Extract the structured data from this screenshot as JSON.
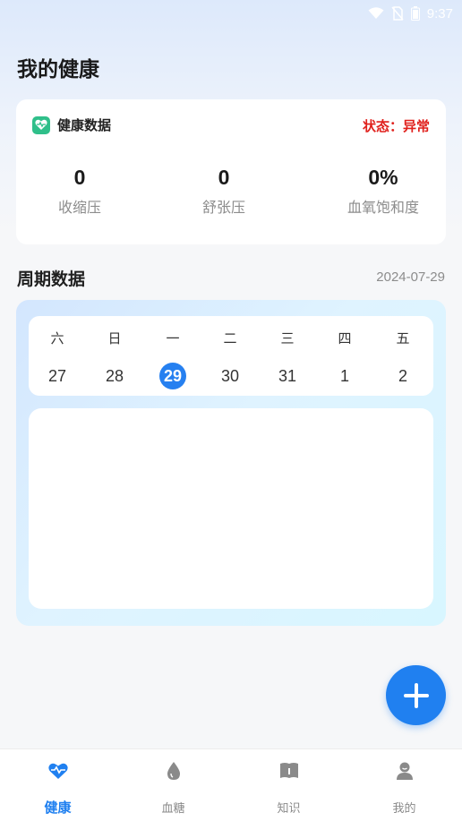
{
  "statusbar": {
    "time": "9:37"
  },
  "page": {
    "title": "我的健康"
  },
  "health_card": {
    "title": "健康数据",
    "status": "状态：异常",
    "stats": [
      {
        "value": "0",
        "label": "收缩压"
      },
      {
        "value": "0",
        "label": "舒张压"
      },
      {
        "value": "0%",
        "label": "血氧饱和度"
      }
    ]
  },
  "period": {
    "title": "周期数据",
    "date": "2024-07-29",
    "days": [
      {
        "weekday": "六",
        "date": "27",
        "selected": false
      },
      {
        "weekday": "日",
        "date": "28",
        "selected": false
      },
      {
        "weekday": "一",
        "date": "29",
        "selected": true
      },
      {
        "weekday": "二",
        "date": "30",
        "selected": false
      },
      {
        "weekday": "三",
        "date": "31",
        "selected": false
      },
      {
        "weekday": "四",
        "date": "1",
        "selected": false
      },
      {
        "weekday": "五",
        "date": "2",
        "selected": false
      }
    ]
  },
  "tabs": [
    {
      "label": "健康",
      "icon": "heart-pulse-icon",
      "active": true
    },
    {
      "label": "血糖",
      "icon": "drop-icon",
      "active": false
    },
    {
      "label": "知识",
      "icon": "book-icon",
      "active": false
    },
    {
      "label": "我的",
      "icon": "user-icon",
      "active": false
    }
  ],
  "colors": {
    "accent": "#2080f0",
    "alert": "#e0201c",
    "health_icon": "#2fbf8a"
  }
}
